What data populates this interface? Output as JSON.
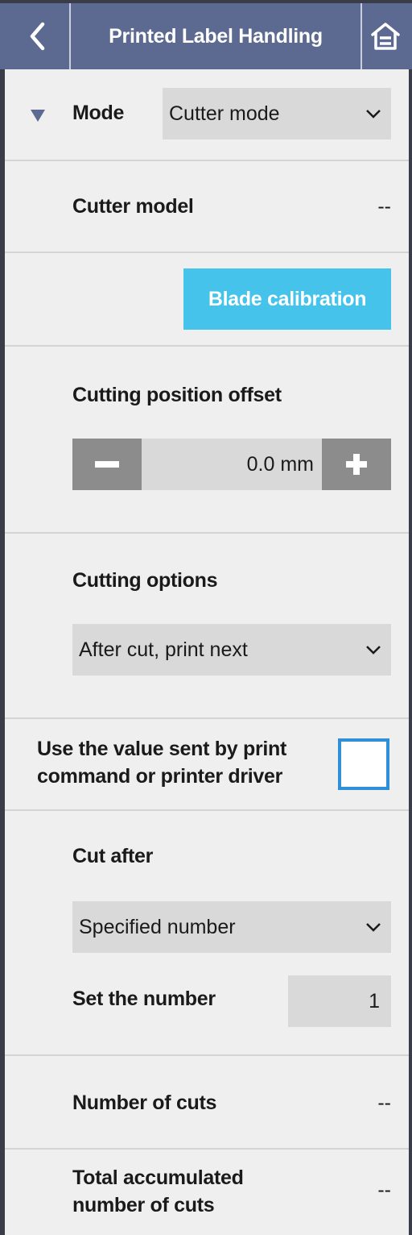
{
  "header": {
    "title": "Printed Label Handling",
    "back_icon": "chevron-left-icon",
    "home_icon": "home-icon",
    "bg_color": "#5c6a92"
  },
  "mode": {
    "label": "Mode",
    "value": "Cutter mode",
    "expand_icon": "triangle-down-icon"
  },
  "cutter_model": {
    "label": "Cutter model",
    "value": "--"
  },
  "blade_calibration": {
    "label": "Blade calibration",
    "color": "#45c3eb"
  },
  "cutting_position_offset": {
    "label": "Cutting position offset",
    "value": "0.0 mm"
  },
  "cutting_options": {
    "label": "Cutting options",
    "value": "After cut, print next"
  },
  "use_driver_value": {
    "line1": "Use the value sent by print",
    "line2": "command or printer driver",
    "checked": false
  },
  "cut_after": {
    "label": "Cut after",
    "value": "Specified number",
    "set_number_label": "Set the number",
    "set_number_value": "1"
  },
  "number_of_cuts": {
    "label": "Number of cuts",
    "value": "--"
  },
  "total_accumulated": {
    "line1": "Total accumulated",
    "line2": "number of cuts",
    "value": "--"
  }
}
